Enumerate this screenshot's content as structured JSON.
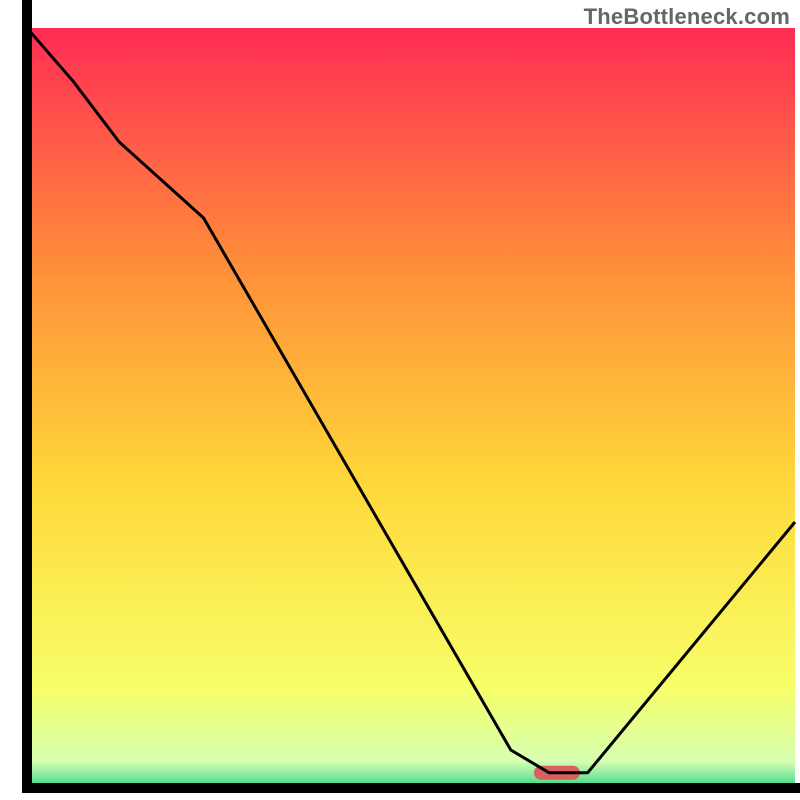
{
  "watermark": "TheBottleneck.com",
  "chart_data": {
    "type": "line",
    "x": [
      0,
      6,
      12,
      23,
      63,
      68,
      73,
      100
    ],
    "values": [
      100,
      93,
      85,
      75,
      5,
      2,
      2,
      35
    ],
    "title": "",
    "xlabel": "",
    "ylabel": "",
    "xlim": [
      0,
      100
    ],
    "ylim": [
      0,
      100
    ],
    "optimal_marker": {
      "x_start": 66,
      "x_end": 72,
      "y": 2
    },
    "background_gradient": {
      "top": "#ff2c55",
      "upper_mid": "#ff8a3a",
      "mid": "#ffd83a",
      "lower_mid": "#f7ff6a",
      "bottom": "#2bd67b"
    }
  }
}
